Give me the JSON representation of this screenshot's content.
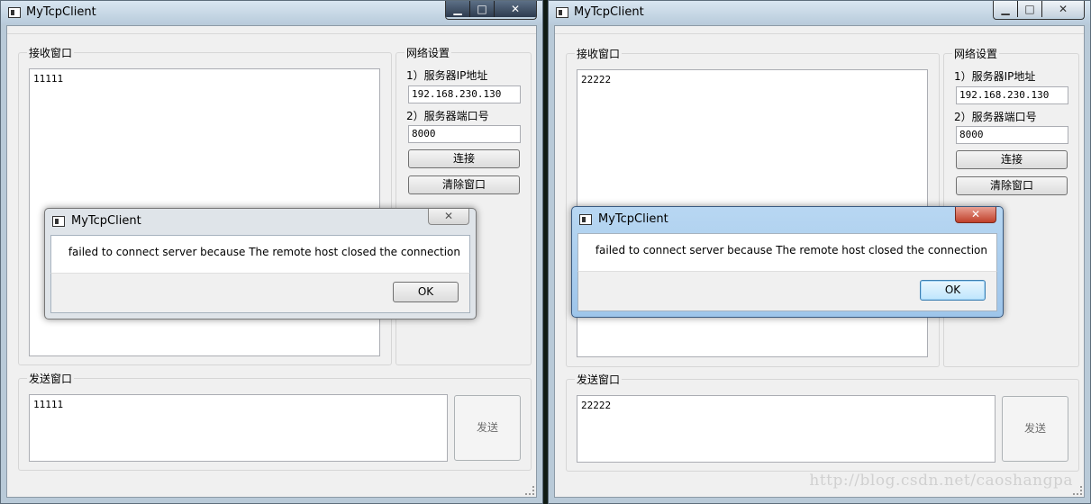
{
  "windows": [
    {
      "title": "MyTcpClient",
      "caption": {
        "minimize": "▁",
        "maximize": "□",
        "close": "✕"
      },
      "recv_group_label": "接收窗口",
      "recv_text": "11111",
      "net_group_label": "网络设置",
      "ip_label": "1）服务器IP地址",
      "ip_value": "192.168.230.130",
      "port_label": "2）服务器端口号",
      "port_value": "8000",
      "connect_label": "连接",
      "clear_label": "清除窗口",
      "send_group_label": "发送窗口",
      "send_text": "11111",
      "send_button_label": "发送"
    },
    {
      "title": "MyTcpClient",
      "caption": {
        "minimize": "▁",
        "maximize": "□",
        "close": "✕"
      },
      "recv_group_label": "接收窗口",
      "recv_text": "22222",
      "net_group_label": "网络设置",
      "ip_label": "1）服务器IP地址",
      "ip_value": "192.168.230.130",
      "port_label": "2）服务器端口号",
      "port_value": "8000",
      "connect_label": "连接",
      "clear_label": "清除窗口",
      "send_group_label": "发送窗口",
      "send_text": "22222",
      "send_button_label": "发送"
    }
  ],
  "dialogs": [
    {
      "title": "MyTcpClient",
      "close": "✕",
      "message": "failed to connect server because The remote host closed the connection",
      "ok_label": "OK"
    },
    {
      "title": "MyTcpClient",
      "close": "✕",
      "message": "failed to connect server because The remote host closed the connection",
      "ok_label": "OK"
    }
  ],
  "watermark": "http://blog.csdn.net/caoshangpa"
}
